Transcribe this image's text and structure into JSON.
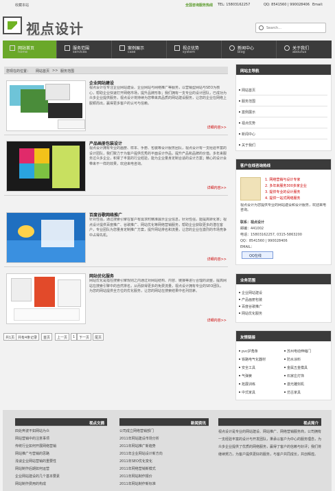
{
  "topbar": {
    "favorite": "收藏本站",
    "phone_label": "全国咨询服务热线",
    "tel": "TEL: 15803162257",
    "qq": "QQ: 8541560 | 990028406",
    "email": "Email:"
  },
  "logo": {
    "name": "视点设计",
    "sub": "www.sdvs.com",
    "colors": {
      "green": "#6fb324",
      "dark": "#4c4c4c"
    }
  },
  "search": {
    "placeholder": "Search..."
  },
  "nav": [
    {
      "t1": "网站首页",
      "t2": "home",
      "icon": "home-icon"
    },
    {
      "t1": "服务范围",
      "t2": "services",
      "icon": "grid-icon"
    },
    {
      "t1": "案例展示",
      "t2": "case",
      "icon": "image-icon"
    },
    {
      "t1": "视点优势",
      "t2": "system",
      "icon": "monitor-icon"
    },
    {
      "t1": "新闻中心",
      "t2": "blog",
      "icon": "heart-icon"
    },
    {
      "t1": "关于我们",
      "t2": "aboutus",
      "icon": "info-icon"
    }
  ],
  "crumb": {
    "pos": "您现在的位置：",
    "home": "网站首页",
    "sep": ">>",
    "cur": "服务范围"
  },
  "articles": [
    {
      "title": "企业网站建设",
      "body": "视点设计在专注企业网站建设、企业网站与网络推广等服务，以营销型网站与SEO为核心，帮助企业快速打开网络市场，提升品牌形象；我们拥有一支专业的设计团队，已成功为众多企业提供服务，视点设计将持续为您带来高品质的网站建设服务，让您的企业在网络上脱颖而出，赢得更多客户的认可与信赖。",
      "more": "详细内容>>"
    },
    {
      "title": "产品画册包装设计",
      "body": "视点设计拥有专业的画册、样本、手册、包装等设计服务团队，视点设计有一支经验丰富的设计团队，我们致力于为客户提供优秀的平面设计作品，提升产品和品牌的价值。多年来服务过众多企业，积累了丰富的行业经验，能为企业量身定制合适的设计方案；精心的设计会带来不一样的效果，欢迎来电咨询。",
      "more": "详细内容>>"
    },
    {
      "title": "百度谷歌网络推广",
      "body": "针对性强，通过搜索引擎在客户有需求时精准展示企业信息，针对性强，能提高转化率；视点设计提供百度推广、谷歌推广、网站优化等网络营销服务，帮助企业获取更多的潜在客户，专业团队为您量身定制推广方案，提升网站排名和流量，让您的企业在激烈的市场竞争中占得先机。",
      "more": "详细内容>>"
    },
    {
      "title": "网站优化服务",
      "body": "网站优化是指在搜索引擎规则之内通过对网站结构、内容、链接等进行合理的调整，提高网站在搜索引擎中的自然排名，从而获得更多的免费流量，视点设计拥有专业的SEO团队，为您的网站提供全方位的优化服务，让您的网站在搜索结果中名列前茅。",
      "more": "详细内容>>"
    }
  ],
  "pager": [
    "共1页",
    "共有4条记录",
    "首页",
    "上一页",
    "1",
    "下一页",
    "尾页"
  ],
  "sidebar1": {
    "title": "网站主导航",
    "items": [
      "网站首页",
      "服务范围",
      "案例展示",
      "视点优势",
      "新闻中心",
      "关于我们"
    ]
  },
  "contact": {
    "title": "客户在线咨询热线",
    "steps": [
      "1. 网络营销与设计专家",
      "2. 多年来服务300多家企业",
      "3. 提供专业的设计服务",
      "4. 提供一站式网络服务"
    ],
    "desc": "视点设计为您提供专业的网站建设和设计服务，欢迎来电咨询。",
    "company": "联系：视点设计",
    "zip": "邮编：441002",
    "tel": "电话：15803162257, 0315-5863200",
    "qq": "QQ：8541560 | 990028406",
    "email": "EMAIL：",
    "qqbtn": "QQ在线"
  },
  "sidebar2": {
    "title": "业务范围",
    "items": [
      "企业网站建设",
      "产品画册包装",
      "百度谷歌推广",
      "网站优化服务"
    ]
  },
  "sidebar3": {
    "title": "友情链接",
    "items": [
      "pvc护角条",
      "苏州电动伸缩门",
      "铁路电气化器材",
      "防水涂料",
      "安全工具",
      "金属五金模具",
      "气弹簧",
      "石家庄灯饰",
      "拓展训练",
      "激光雕刻机",
      "中式家具",
      "仿古家具"
    ]
  },
  "footer": {
    "col1": {
      "title": "视点文摘",
      "items": [
        "四处奔波不如网站为众",
        "网站营销中的注意事项",
        "传统行业如何开展网络营销",
        "网站推广与营销的思路",
        "浅谈企业网站营销的重要性",
        "网站制作后期如何运营",
        "企业网站建设的几个基本要素",
        "网站制作费用的构成"
      ]
    },
    "col2": {
      "title": "新闻资讯",
      "items": [
        "公司成立网络营销部门",
        "2011年网站建设市场分析",
        "2011年网站推广新趋势",
        "2011年企业网站设计新方向",
        "2011年SEO优化变化",
        "2011年网络营销新模式",
        "2011年网站制作报价",
        "2011年网站制作新标准"
      ]
    },
    "col3": {
      "title": "视点简介",
      "text": "视点设计是专业的网站建设、网站推广、网络营销服务商，公司拥有一支经验丰富的设计与开发团队，秉承以客户为中心的服务理念，为众多企业提供了优质的网络服务，赢得了客户的信赖与好评；我们将继续努力，为客户提供更好的服务，与客户共同成长，共创辉煌。"
    }
  }
}
